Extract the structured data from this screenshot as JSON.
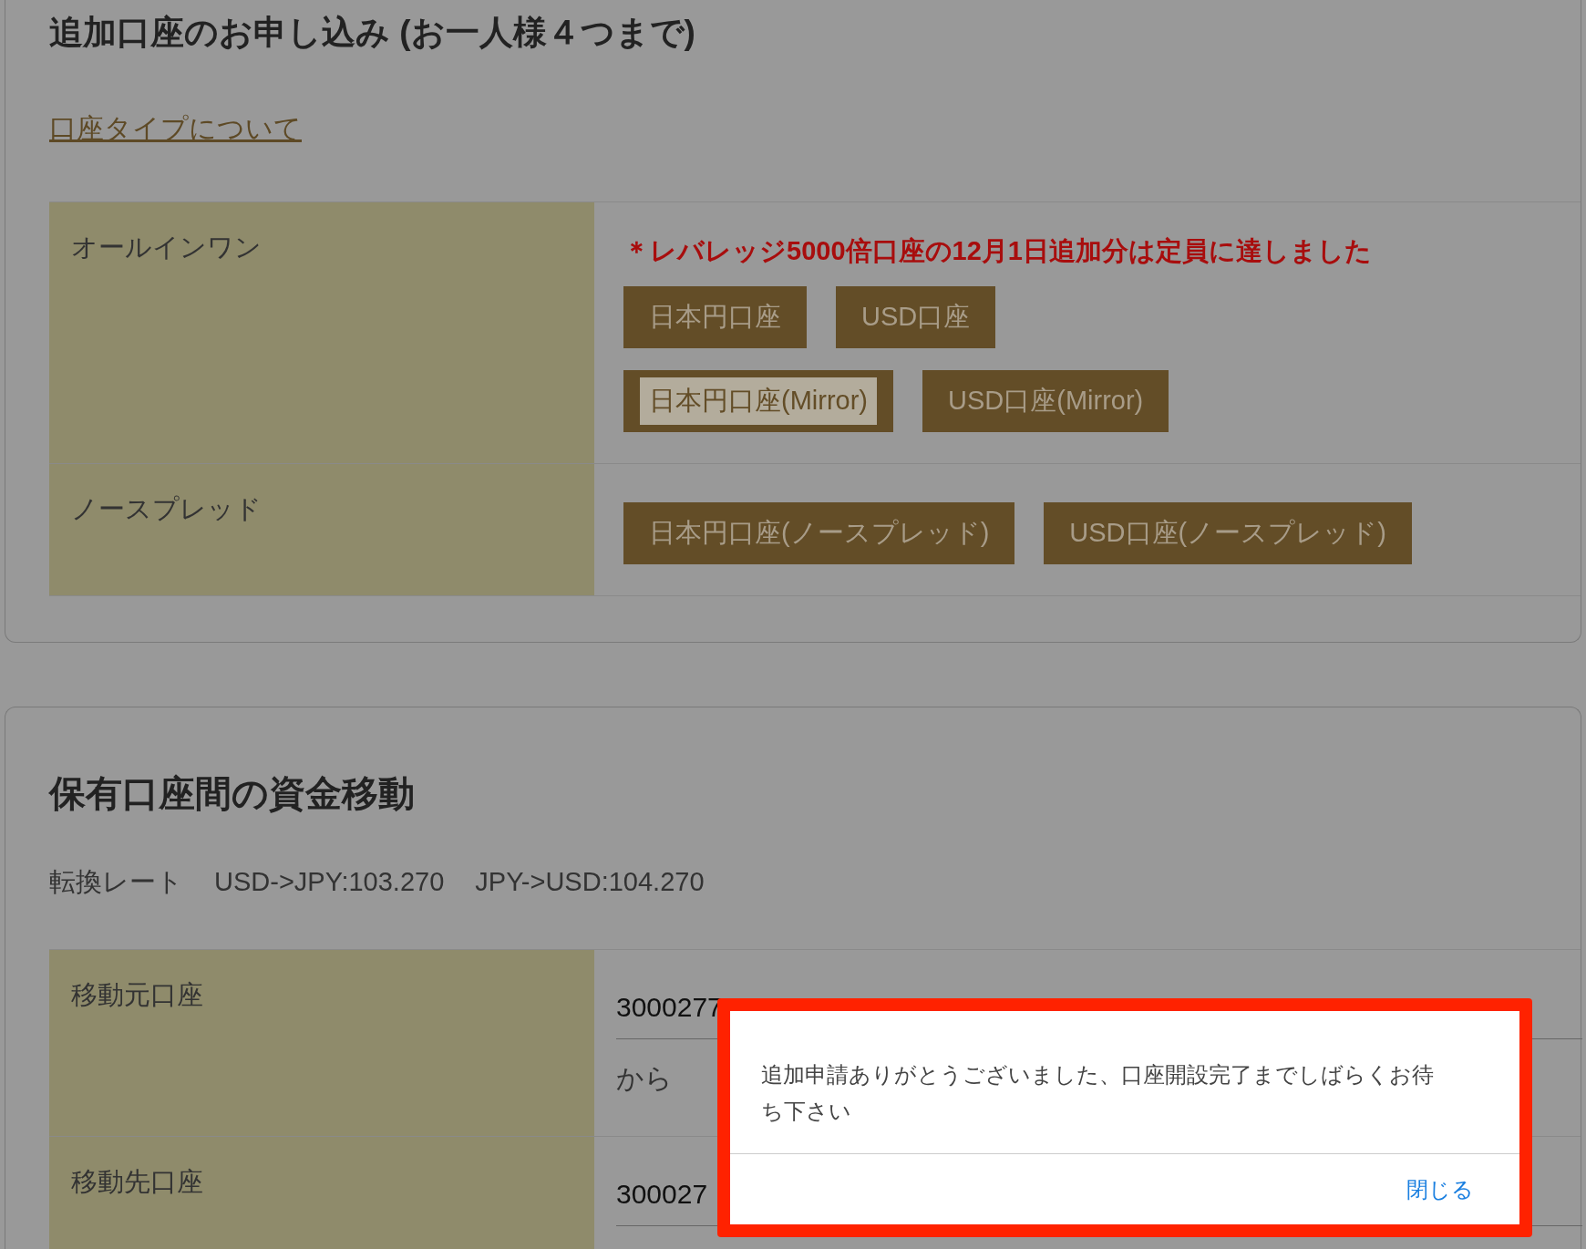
{
  "apply_section": {
    "title": "追加口座のお申し込み (お一人様４つまで)",
    "link": "口座タイプについて",
    "rows": [
      {
        "label": "オールインワン",
        "notice": "＊レバレッジ5000倍口座の12月1日追加分は定員に達しました",
        "button_rows": [
          [
            {
              "label": "日本円口座",
              "focused": false
            },
            {
              "label": "USD口座",
              "focused": false
            }
          ],
          [
            {
              "label": "日本円口座(Mirror)",
              "focused": true
            },
            {
              "label": "USD口座(Mirror)",
              "focused": false
            }
          ]
        ]
      },
      {
        "label": "ノースプレッド",
        "button_rows": [
          [
            {
              "label": "日本円口座(ノースプレッド)",
              "focused": false
            },
            {
              "label": "USD口座(ノースプレッド)",
              "focused": false
            }
          ]
        ]
      }
    ]
  },
  "transfer_section": {
    "title": "保有口座間の資金移動",
    "rate_label": "転換レート",
    "rates": [
      "USD->JPY:103.270",
      "JPY->USD:104.270"
    ],
    "rows": [
      {
        "label": "移動元口座",
        "value": "3000277",
        "suffix": "から"
      },
      {
        "label": "移動先口座",
        "value": "300027"
      }
    ]
  },
  "dialog": {
    "message": "追加申請ありがとうございました、口座開設完了までしばらくお待ち下さい",
    "close": "閉じる",
    "highlighted": true
  }
}
